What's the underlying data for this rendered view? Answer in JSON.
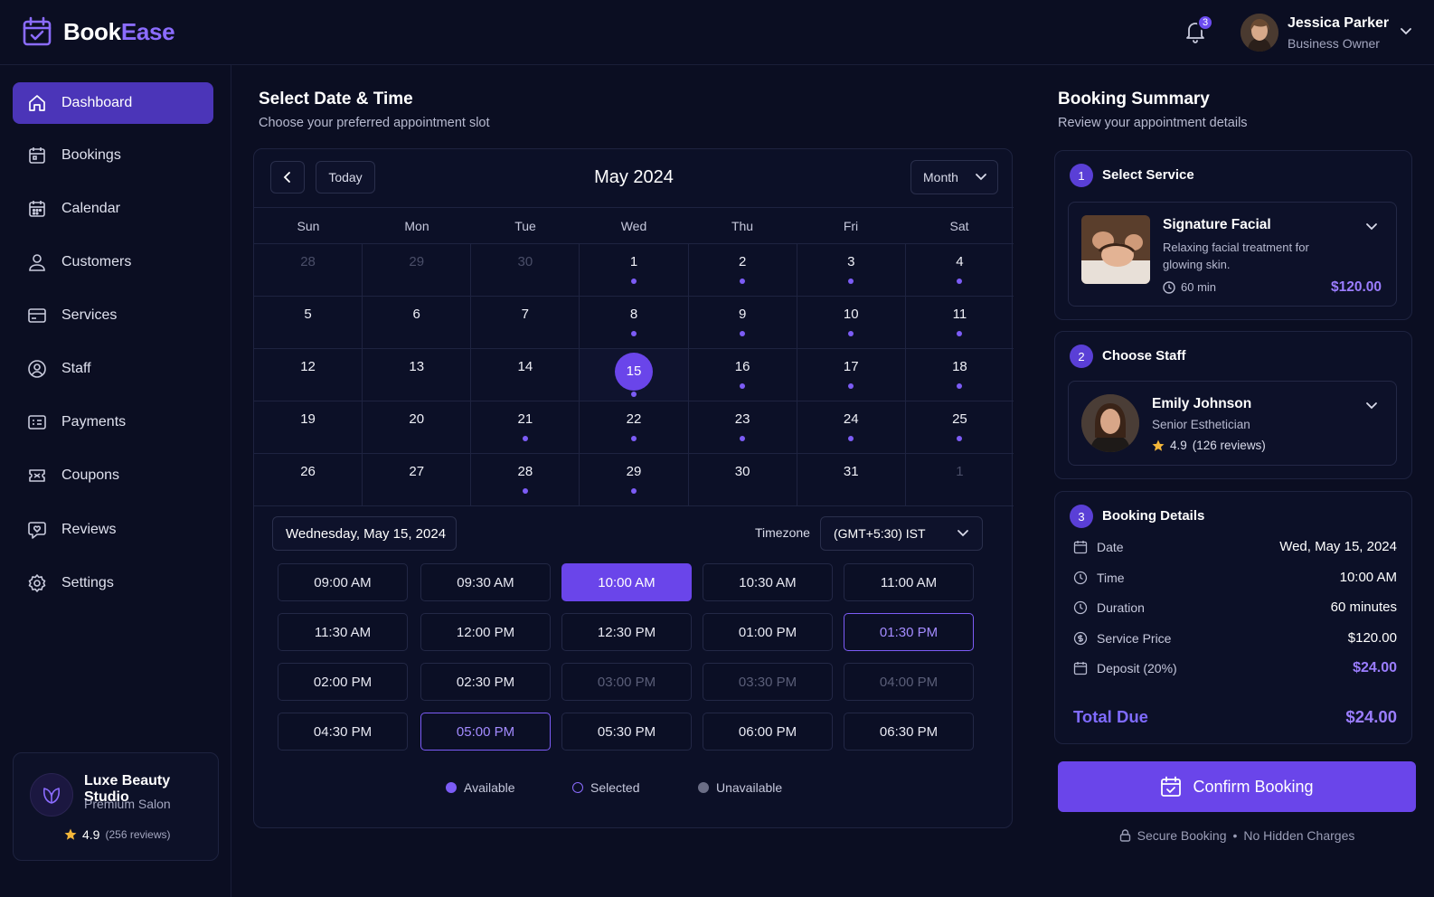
{
  "brand": {
    "name_part1": "Book",
    "name_part2": "Ease",
    "icon": "calendar-check-icon",
    "accent": "#8b6cff"
  },
  "header": {
    "notifications_count": "3",
    "user_name": "Jessica Parker",
    "user_role": "Business Owner"
  },
  "sidebar": {
    "items": [
      {
        "label": "Dashboard",
        "icon": "home-icon",
        "active": true
      },
      {
        "label": "Bookings",
        "icon": "calendar-icon"
      },
      {
        "label": "Calendar",
        "icon": "calendar-grid-icon"
      },
      {
        "label": "Customers",
        "icon": "user-icon"
      },
      {
        "label": "Services",
        "icon": "card-icon"
      },
      {
        "label": "Staff",
        "icon": "user-circle-icon"
      },
      {
        "label": "Payments",
        "icon": "receipt-icon"
      },
      {
        "label": "Coupons",
        "icon": "ticket-icon"
      },
      {
        "label": "Reviews",
        "icon": "heart-chat-icon"
      },
      {
        "label": "Settings",
        "icon": "gear-icon"
      }
    ],
    "studio": {
      "name": "Luxe Beauty Studio",
      "type": "Premium Salon",
      "rating": "4.9",
      "reviews": "(256 reviews)"
    }
  },
  "main": {
    "title": "Select Date & Time",
    "subtitle": "Choose your preferred appointment slot",
    "today_label": "Today",
    "month_label": "May 2024",
    "view_label": "Month",
    "weekdays": [
      "Sun",
      "Mon",
      "Tue",
      "Wed",
      "Thu",
      "Fri",
      "Sat"
    ],
    "weeks": [
      [
        {
          "d": "28",
          "muted": true
        },
        {
          "d": "29",
          "muted": true
        },
        {
          "d": "30",
          "muted": true
        },
        {
          "d": "1",
          "dot": true
        },
        {
          "d": "2",
          "dot": true
        },
        {
          "d": "3",
          "dot": true
        },
        {
          "d": "4",
          "dot": true
        }
      ],
      [
        {
          "d": "5"
        },
        {
          "d": "6"
        },
        {
          "d": "7"
        },
        {
          "d": "8",
          "dot": true
        },
        {
          "d": "9",
          "dot": true
        },
        {
          "d": "10",
          "dot": true
        },
        {
          "d": "11",
          "dot": true
        }
      ],
      [
        {
          "d": "12"
        },
        {
          "d": "13"
        },
        {
          "d": "14"
        },
        {
          "d": "15",
          "dot": true,
          "selected": true
        },
        {
          "d": "16",
          "dot": true
        },
        {
          "d": "17",
          "dot": true
        },
        {
          "d": "18",
          "dot": true
        }
      ],
      [
        {
          "d": "19"
        },
        {
          "d": "20"
        },
        {
          "d": "21",
          "dot": true
        },
        {
          "d": "22",
          "dot": true
        },
        {
          "d": "23",
          "dot": true
        },
        {
          "d": "24",
          "dot": true
        },
        {
          "d": "25",
          "dot": true
        }
      ],
      [
        {
          "d": "26"
        },
        {
          "d": "27"
        },
        {
          "d": "28",
          "dot": true
        },
        {
          "d": "29",
          "dot": true
        },
        {
          "d": "30"
        },
        {
          "d": "31"
        },
        {
          "d": "1",
          "muted": true
        }
      ]
    ],
    "selected_date": "Wednesday, May 15, 2024",
    "timezone_label": "Timezone",
    "timezone_value": "(GMT+5:30) IST",
    "slots": [
      {
        "t": "09:00 AM",
        "s": "available"
      },
      {
        "t": "09:30 AM",
        "s": "available"
      },
      {
        "t": "10:00 AM",
        "s": "active"
      },
      {
        "t": "10:30 AM",
        "s": "available"
      },
      {
        "t": "11:00 AM",
        "s": "available"
      },
      {
        "t": "11:30 AM",
        "s": "available"
      },
      {
        "t": "12:00 PM",
        "s": "available"
      },
      {
        "t": "12:30 PM",
        "s": "available"
      },
      {
        "t": "01:00 PM",
        "s": "available"
      },
      {
        "t": "01:30 PM",
        "s": "outlined"
      },
      {
        "t": "02:00 PM",
        "s": "available"
      },
      {
        "t": "02:30 PM",
        "s": "available"
      },
      {
        "t": "03:00 PM",
        "s": "unavailable"
      },
      {
        "t": "03:30 PM",
        "s": "unavailable"
      },
      {
        "t": "04:00 PM",
        "s": "unavailable"
      },
      {
        "t": "04:30 PM",
        "s": "available"
      },
      {
        "t": "05:00 PM",
        "s": "outlined"
      },
      {
        "t": "05:30 PM",
        "s": "available"
      },
      {
        "t": "06:00 PM",
        "s": "available"
      },
      {
        "t": "06:30 PM",
        "s": "available"
      }
    ],
    "legend": {
      "available": "Available",
      "selected": "Selected",
      "unavailable": "Unavailable"
    }
  },
  "summary": {
    "title": "Booking Summary",
    "subtitle": "Review your appointment details",
    "step1": {
      "num": "1",
      "title": "Select Service",
      "name": "Signature Facial",
      "desc": "Relaxing facial treatment for glowing skin.",
      "duration": "60 min",
      "price": "$120.00"
    },
    "step2": {
      "num": "2",
      "title": "Choose Staff",
      "name": "Emily Johnson",
      "role": "Senior Esthetician",
      "rating": "4.9",
      "reviews": "(126 reviews)"
    },
    "step3": {
      "num": "3",
      "title": "Booking Details",
      "rows": [
        {
          "label": "Date",
          "value": "Wed, May 15, 2024",
          "icon": "calendar-icon"
        },
        {
          "label": "Time",
          "value": "10:00 AM",
          "icon": "clock-icon"
        },
        {
          "label": "Duration",
          "value": "60 minutes",
          "icon": "clock-icon"
        },
        {
          "label": "Service Price",
          "value": "$120.00",
          "icon": "price-tag-icon"
        },
        {
          "label": "Deposit (20%)",
          "value": "$24.00",
          "icon": "calendar-icon",
          "accent": true
        }
      ],
      "total_label": "Total Due",
      "total_value": "$24.00"
    },
    "confirm_label": "Confirm Booking",
    "secure_label": "Secure Booking",
    "no_fees_label": "No Hidden Charges"
  }
}
